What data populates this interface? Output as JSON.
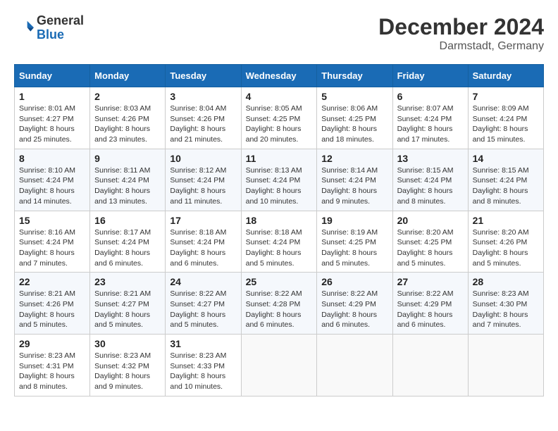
{
  "header": {
    "logo": {
      "line1": "General",
      "line2": "Blue"
    },
    "title": "December 2024",
    "subtitle": "Darmstadt, Germany"
  },
  "calendar": {
    "days_of_week": [
      "Sunday",
      "Monday",
      "Tuesday",
      "Wednesday",
      "Thursday",
      "Friday",
      "Saturday"
    ],
    "weeks": [
      [
        {
          "day": "1",
          "sunrise": "8:01 AM",
          "sunset": "4:27 PM",
          "daylight": "8 hours and 25 minutes."
        },
        {
          "day": "2",
          "sunrise": "8:03 AM",
          "sunset": "4:26 PM",
          "daylight": "8 hours and 23 minutes."
        },
        {
          "day": "3",
          "sunrise": "8:04 AM",
          "sunset": "4:26 PM",
          "daylight": "8 hours and 21 minutes."
        },
        {
          "day": "4",
          "sunrise": "8:05 AM",
          "sunset": "4:25 PM",
          "daylight": "8 hours and 20 minutes."
        },
        {
          "day": "5",
          "sunrise": "8:06 AM",
          "sunset": "4:25 PM",
          "daylight": "8 hours and 18 minutes."
        },
        {
          "day": "6",
          "sunrise": "8:07 AM",
          "sunset": "4:24 PM",
          "daylight": "8 hours and 17 minutes."
        },
        {
          "day": "7",
          "sunrise": "8:09 AM",
          "sunset": "4:24 PM",
          "daylight": "8 hours and 15 minutes."
        }
      ],
      [
        {
          "day": "8",
          "sunrise": "8:10 AM",
          "sunset": "4:24 PM",
          "daylight": "8 hours and 14 minutes."
        },
        {
          "day": "9",
          "sunrise": "8:11 AM",
          "sunset": "4:24 PM",
          "daylight": "8 hours and 13 minutes."
        },
        {
          "day": "10",
          "sunrise": "8:12 AM",
          "sunset": "4:24 PM",
          "daylight": "8 hours and 11 minutes."
        },
        {
          "day": "11",
          "sunrise": "8:13 AM",
          "sunset": "4:24 PM",
          "daylight": "8 hours and 10 minutes."
        },
        {
          "day": "12",
          "sunrise": "8:14 AM",
          "sunset": "4:24 PM",
          "daylight": "8 hours and 9 minutes."
        },
        {
          "day": "13",
          "sunrise": "8:15 AM",
          "sunset": "4:24 PM",
          "daylight": "8 hours and 8 minutes."
        },
        {
          "day": "14",
          "sunrise": "8:15 AM",
          "sunset": "4:24 PM",
          "daylight": "8 hours and 8 minutes."
        }
      ],
      [
        {
          "day": "15",
          "sunrise": "8:16 AM",
          "sunset": "4:24 PM",
          "daylight": "8 hours and 7 minutes."
        },
        {
          "day": "16",
          "sunrise": "8:17 AM",
          "sunset": "4:24 PM",
          "daylight": "8 hours and 6 minutes."
        },
        {
          "day": "17",
          "sunrise": "8:18 AM",
          "sunset": "4:24 PM",
          "daylight": "8 hours and 6 minutes."
        },
        {
          "day": "18",
          "sunrise": "8:18 AM",
          "sunset": "4:24 PM",
          "daylight": "8 hours and 5 minutes."
        },
        {
          "day": "19",
          "sunrise": "8:19 AM",
          "sunset": "4:25 PM",
          "daylight": "8 hours and 5 minutes."
        },
        {
          "day": "20",
          "sunrise": "8:20 AM",
          "sunset": "4:25 PM",
          "daylight": "8 hours and 5 minutes."
        },
        {
          "day": "21",
          "sunrise": "8:20 AM",
          "sunset": "4:26 PM",
          "daylight": "8 hours and 5 minutes."
        }
      ],
      [
        {
          "day": "22",
          "sunrise": "8:21 AM",
          "sunset": "4:26 PM",
          "daylight": "8 hours and 5 minutes."
        },
        {
          "day": "23",
          "sunrise": "8:21 AM",
          "sunset": "4:27 PM",
          "daylight": "8 hours and 5 minutes."
        },
        {
          "day": "24",
          "sunrise": "8:22 AM",
          "sunset": "4:27 PM",
          "daylight": "8 hours and 5 minutes."
        },
        {
          "day": "25",
          "sunrise": "8:22 AM",
          "sunset": "4:28 PM",
          "daylight": "8 hours and 6 minutes."
        },
        {
          "day": "26",
          "sunrise": "8:22 AM",
          "sunset": "4:29 PM",
          "daylight": "8 hours and 6 minutes."
        },
        {
          "day": "27",
          "sunrise": "8:22 AM",
          "sunset": "4:29 PM",
          "daylight": "8 hours and 6 minutes."
        },
        {
          "day": "28",
          "sunrise": "8:23 AM",
          "sunset": "4:30 PM",
          "daylight": "8 hours and 7 minutes."
        }
      ],
      [
        {
          "day": "29",
          "sunrise": "8:23 AM",
          "sunset": "4:31 PM",
          "daylight": "8 hours and 8 minutes."
        },
        {
          "day": "30",
          "sunrise": "8:23 AM",
          "sunset": "4:32 PM",
          "daylight": "8 hours and 9 minutes."
        },
        {
          "day": "31",
          "sunrise": "8:23 AM",
          "sunset": "4:33 PM",
          "daylight": "8 hours and 10 minutes."
        },
        null,
        null,
        null,
        null
      ]
    ]
  }
}
